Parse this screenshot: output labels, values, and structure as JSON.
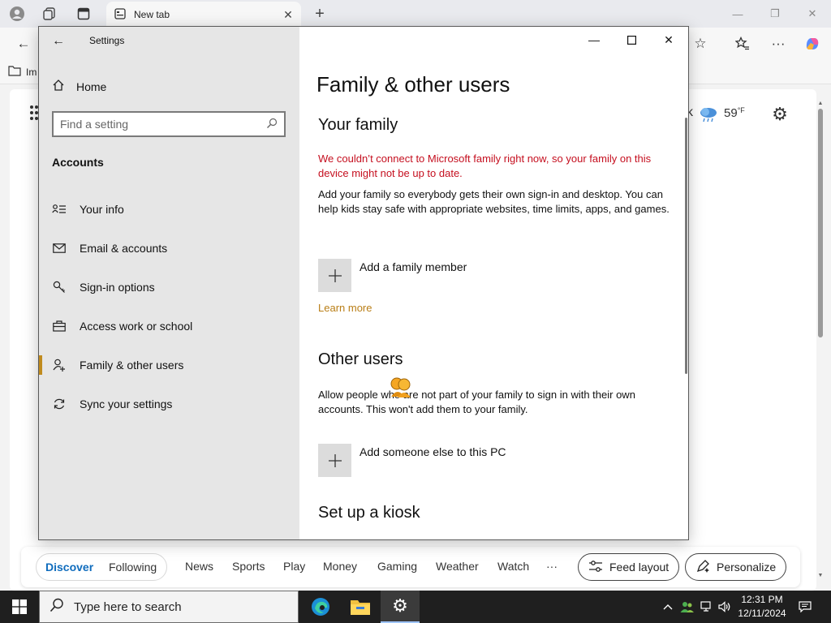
{
  "browser": {
    "tab": {
      "title": "New tab"
    },
    "favorites": {
      "item1": "Im"
    }
  },
  "ntp": {
    "weather": {
      "partial_label": "k",
      "temp": "59",
      "unit": "°F"
    },
    "feed_nav": {
      "pills": [
        "Discover",
        "Following"
      ],
      "links": [
        "News",
        "Sports",
        "Play",
        "Money",
        "Gaming",
        "Weather",
        "Watch",
        "···"
      ],
      "feed_layout": "Feed layout",
      "personalize": "Personalize"
    }
  },
  "settings": {
    "title": "Settings",
    "home": "Home",
    "search_placeholder": "Find a setting",
    "section": "Accounts",
    "nav_items": [
      "Your info",
      "Email & accounts",
      "Sign-in options",
      "Access work or school",
      "Family & other users",
      "Sync your settings"
    ],
    "content": {
      "page_title": "Family & other users",
      "your_family_heading": "Your family",
      "error": "We couldn’t connect to Microsoft family right now, so your family on this device might not be up to date.",
      "family_desc": "Add your family so everybody gets their own sign-in and desktop. You can help kids stay safe with appropriate websites, time limits, apps, and games.",
      "add_family": "Add a family member",
      "learn_more": "Learn more",
      "other_users_heading": "Other users",
      "other_desc": "Allow people who are not part of your family to sign in with their own accounts. This won't add them to your family.",
      "add_someone": "Add someone else to this PC",
      "kiosk_heading": "Set up a kiosk"
    }
  },
  "taskbar": {
    "search_placeholder": "Type here to search",
    "time": "12:31 PM",
    "date": "12/11/2024"
  },
  "colors": {
    "accent": "#0f6cbd",
    "selection_bar": "#c08b1e",
    "error": "#c50f1f",
    "link": "#b97e16"
  }
}
